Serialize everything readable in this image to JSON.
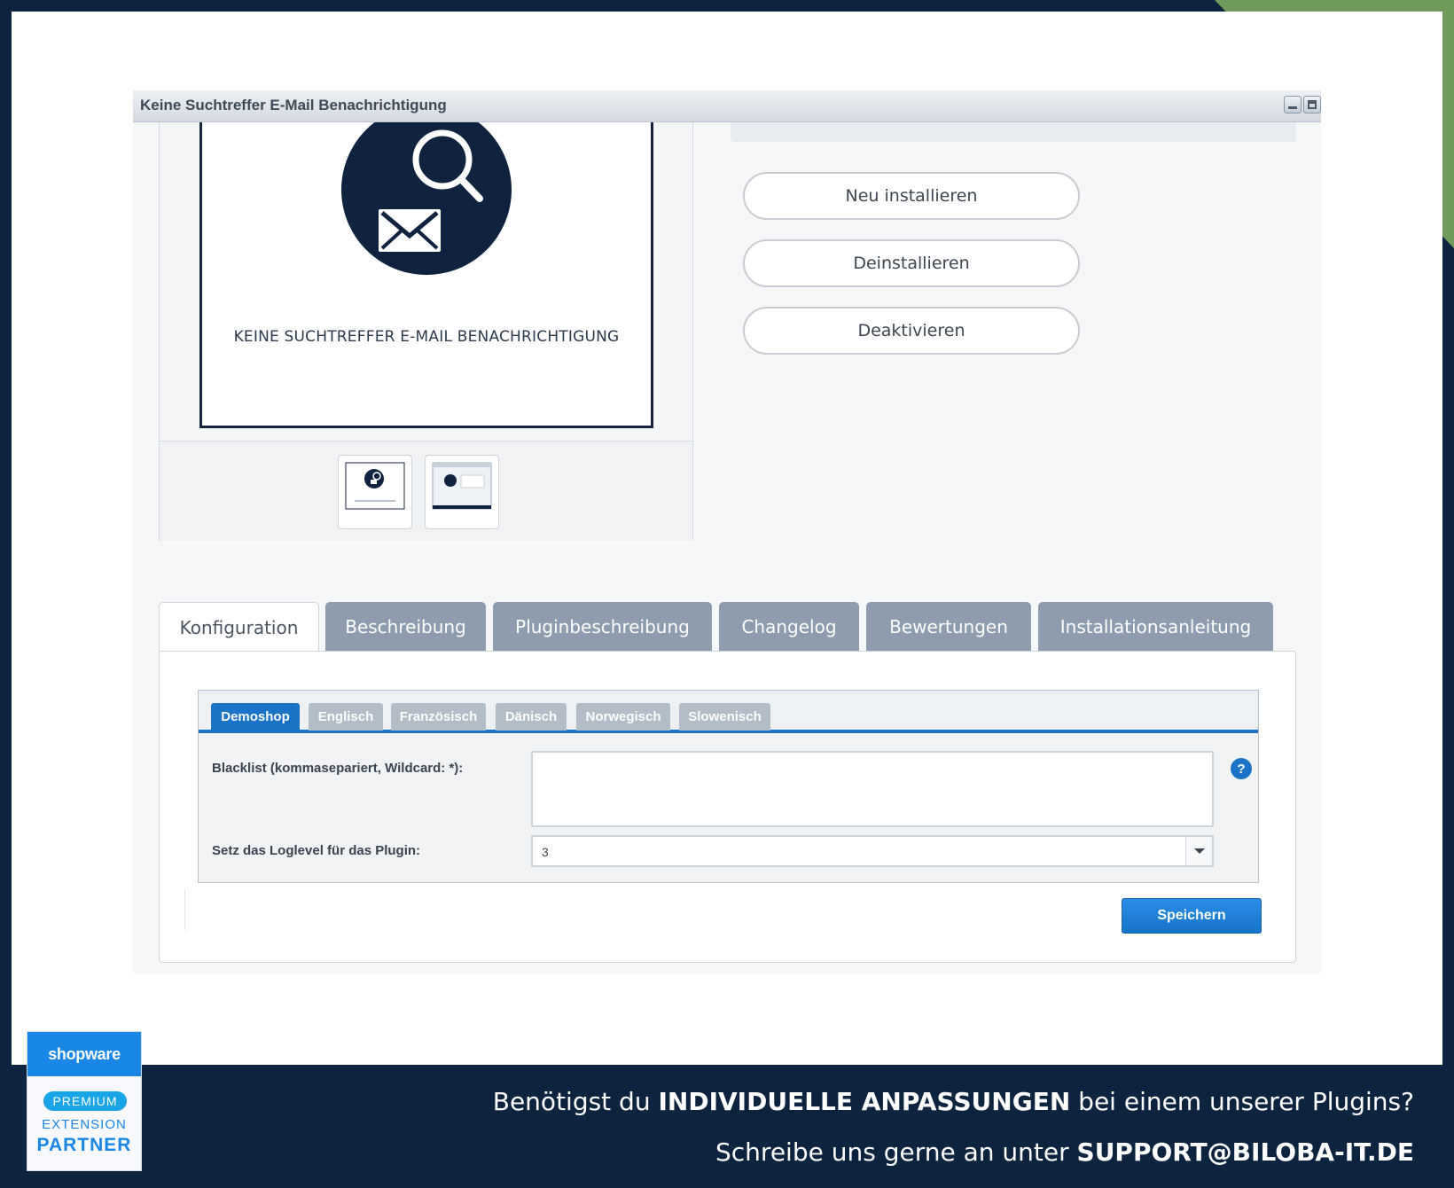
{
  "window": {
    "title": "Keine Suchtreffer E-Mail Benachrichtigung"
  },
  "preview": {
    "caption": "KEINE SUCHTREFFER E-MAIL BENACHRICHTIGUNG",
    "thumbnails": [
      "thumbnail-1",
      "thumbnail-2"
    ]
  },
  "actions": {
    "reinstall": "Neu installieren",
    "uninstall": "Deinstallieren",
    "deactivate": "Deaktivieren"
  },
  "tabs": [
    {
      "label": "Konfiguration",
      "active": true
    },
    {
      "label": "Beschreibung",
      "active": false
    },
    {
      "label": "Pluginbeschreibung",
      "active": false
    },
    {
      "label": "Changelog",
      "active": false
    },
    {
      "label": "Bewertungen",
      "active": false
    },
    {
      "label": "Installationsanleitung",
      "active": false
    }
  ],
  "shop_tabs": [
    {
      "label": "Demoshop",
      "active": true
    },
    {
      "label": "Englisch",
      "active": false
    },
    {
      "label": "Französisch",
      "active": false
    },
    {
      "label": "Dänisch",
      "active": false
    },
    {
      "label": "Norwegisch",
      "active": false
    },
    {
      "label": "Slowenisch",
      "active": false
    }
  ],
  "form": {
    "blacklist_label": "Blacklist (kommasepariert, Wildcard: *):",
    "blacklist_value": "",
    "loglevel_label": "Setz das Loglevel für das Plugin:",
    "loglevel_value": "3",
    "help": "?"
  },
  "save_label": "Speichern",
  "badge": {
    "logo": "shopware",
    "tier": "PREMIUM",
    "line1": "EXTENSION",
    "line2": "PARTNER"
  },
  "promo": {
    "line1_pre": "Benötigst du ",
    "line1_bold": "INDIVIDUELLE ANPASSUNGEN",
    "line1_post": " bei einem unserer Plugins?",
    "line2_pre": "Schreibe uns gerne an unter ",
    "line2_bold": "SUPPORT@BILOBA-IT.DE"
  },
  "colors": {
    "background": "#0d2440",
    "accent_green": "#6f9a5b",
    "primary_blue": "#1a73c7",
    "tab_grey": "#8d9daf"
  }
}
